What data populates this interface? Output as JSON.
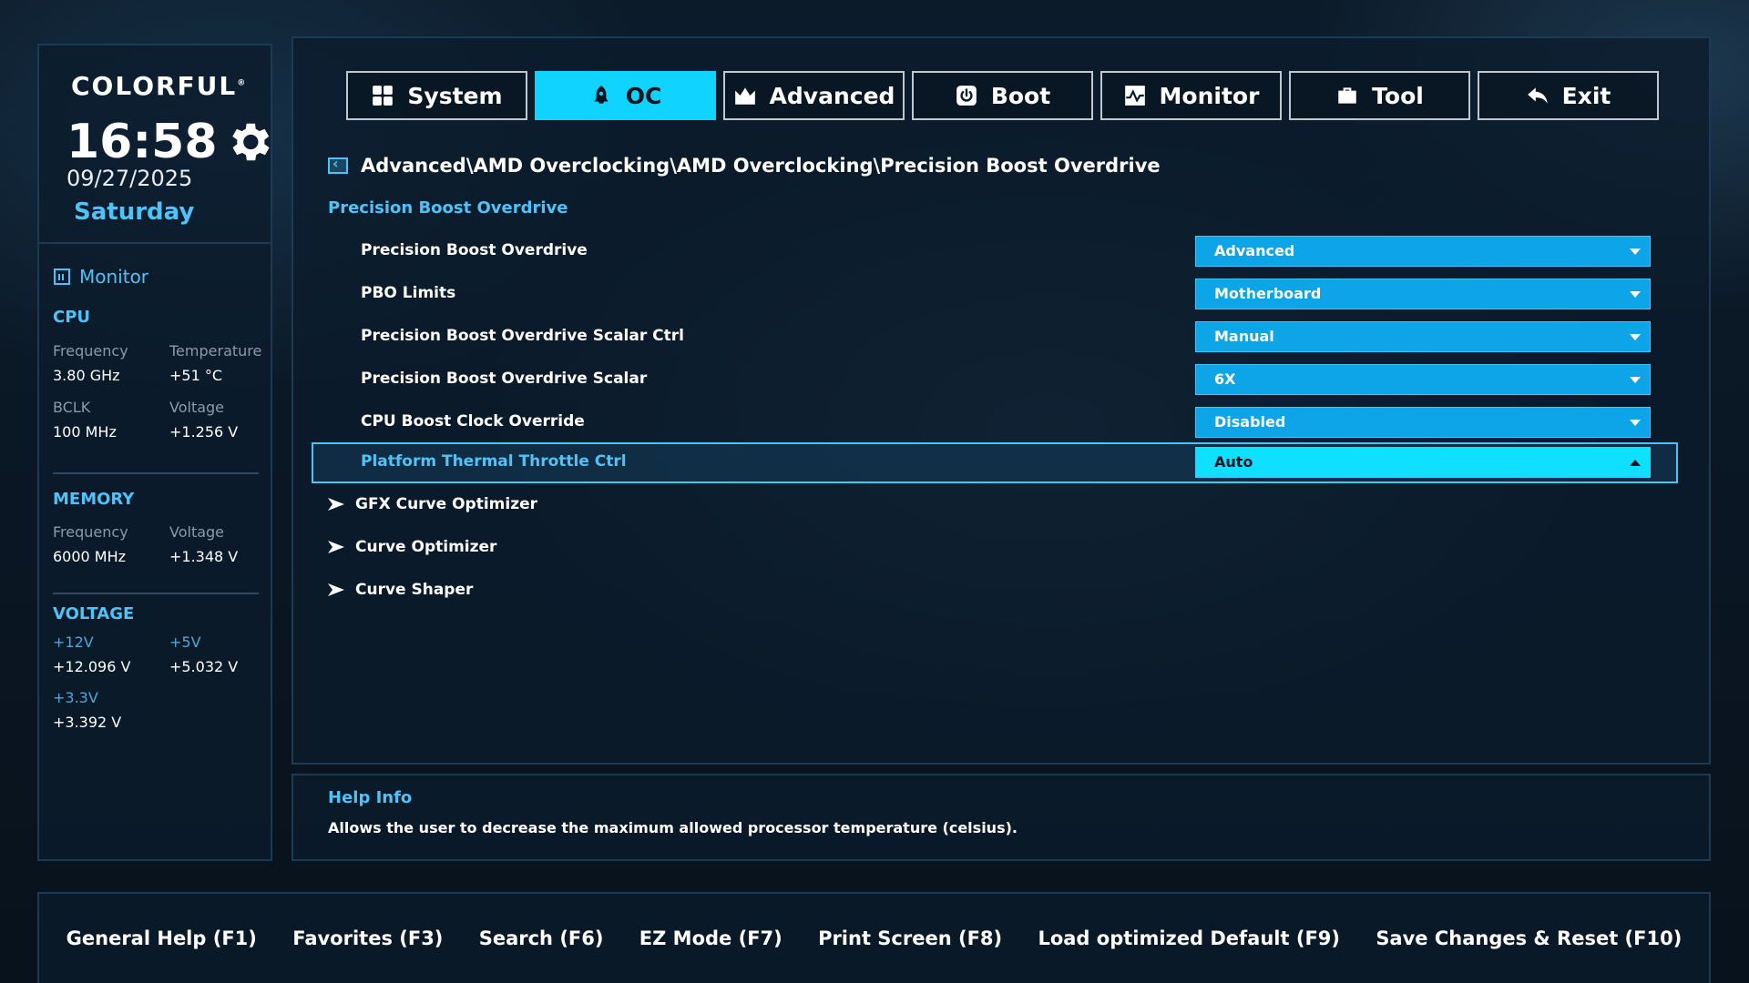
{
  "brand": {
    "logo": "COLORFUL",
    "reg": "®",
    "time": "16:58",
    "date": "09/27/2025",
    "weekday": "Saturday"
  },
  "monitor": {
    "title": "Monitor",
    "cpu": {
      "title": "CPU",
      "frequency_label": "Frequency",
      "frequency_value": "3.80 GHz",
      "temperature_label": "Temperature",
      "temperature_value": "+51 °C",
      "bclk_label": "BCLK",
      "bclk_value": "100 MHz",
      "voltage_label": "Voltage",
      "voltage_value": "+1.256 V"
    },
    "memory": {
      "title": "MEMORY",
      "frequency_label": "Frequency",
      "frequency_value": "6000 MHz",
      "voltage_label": "Voltage",
      "voltage_value": "+1.348 V"
    },
    "voltage": {
      "title": "VOLTAGE",
      "v12_label": "+12V",
      "v12_value": "+12.096 V",
      "v5_label": "+5V",
      "v5_value": "+5.032 V",
      "v33_label": "+3.3V",
      "v33_value": "+3.392 V"
    }
  },
  "tabs": [
    {
      "label": "System",
      "icon": "grid-icon"
    },
    {
      "label": "OC",
      "icon": "rocket-icon"
    },
    {
      "label": "Advanced",
      "icon": "crown-icon"
    },
    {
      "label": "Boot",
      "icon": "power-icon"
    },
    {
      "label": "Monitor",
      "icon": "pulse-icon"
    },
    {
      "label": "Tool",
      "icon": "toolbox-icon"
    },
    {
      "label": "Exit",
      "icon": "reply-icon"
    }
  ],
  "active_tab": "OC",
  "breadcrumb": "Advanced\\AMD Overclocking\\AMD Overclocking\\Precision Boost Overdrive",
  "section_title": "Precision Boost Overdrive",
  "settings": [
    {
      "label": "Precision Boost Overdrive",
      "value": "Advanced"
    },
    {
      "label": "PBO Limits",
      "value": "Motherboard"
    },
    {
      "label": "Precision Boost Overdrive Scalar Ctrl",
      "value": "Manual"
    },
    {
      "label": "Precision Boost Overdrive Scalar",
      "value": "6X"
    },
    {
      "label": "CPU Boost Clock Override",
      "value": "Disabled"
    },
    {
      "label": "Platform Thermal Throttle Ctrl",
      "value": "Auto"
    }
  ],
  "submenus": [
    {
      "label": "GFX Curve Optimizer"
    },
    {
      "label": "Curve Optimizer"
    },
    {
      "label": "Curve Shaper"
    }
  ],
  "help": {
    "title": "Help Info",
    "text": "Allows the user to decrease the maximum allowed processor temperature (celsius)."
  },
  "footer": [
    {
      "label": "General Help (F1)"
    },
    {
      "label": "Favorites (F3)"
    },
    {
      "label": "Search (F6)"
    },
    {
      "label": "EZ Mode (F7)"
    },
    {
      "label": "Print Screen (F8)"
    },
    {
      "label": "Load optimized Default (F9)"
    },
    {
      "label": "Save Changes & Reset (F10)"
    }
  ],
  "colors": {
    "accent": "#4fc3f7",
    "active_tab": "#10d4ff",
    "dropdown": "#0ea5e8",
    "selected_dropdown": "#10e0ff"
  }
}
